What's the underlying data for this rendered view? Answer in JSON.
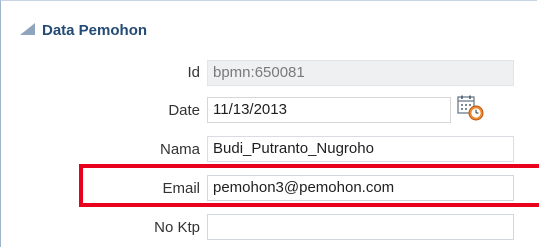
{
  "section": {
    "title": "Data Pemohon"
  },
  "fields": {
    "id": {
      "label": "Id",
      "value": "bpmn:650081"
    },
    "date": {
      "label": "Date",
      "value": "11/13/2013"
    },
    "nama": {
      "label": "Nama",
      "value": "Budi_Putranto_Nugroho"
    },
    "email": {
      "label": "Email",
      "value": "pemohon3@pemohon.com"
    },
    "no_ktp": {
      "label": "No Ktp",
      "value": ""
    }
  },
  "colors": {
    "header_text": "#234b74",
    "highlight": "#e8001c",
    "readonly_bg": "#eef0f2"
  },
  "icons": {
    "collapse": "triangle-collapse-icon",
    "date_picker": "calendar-clock-icon"
  }
}
